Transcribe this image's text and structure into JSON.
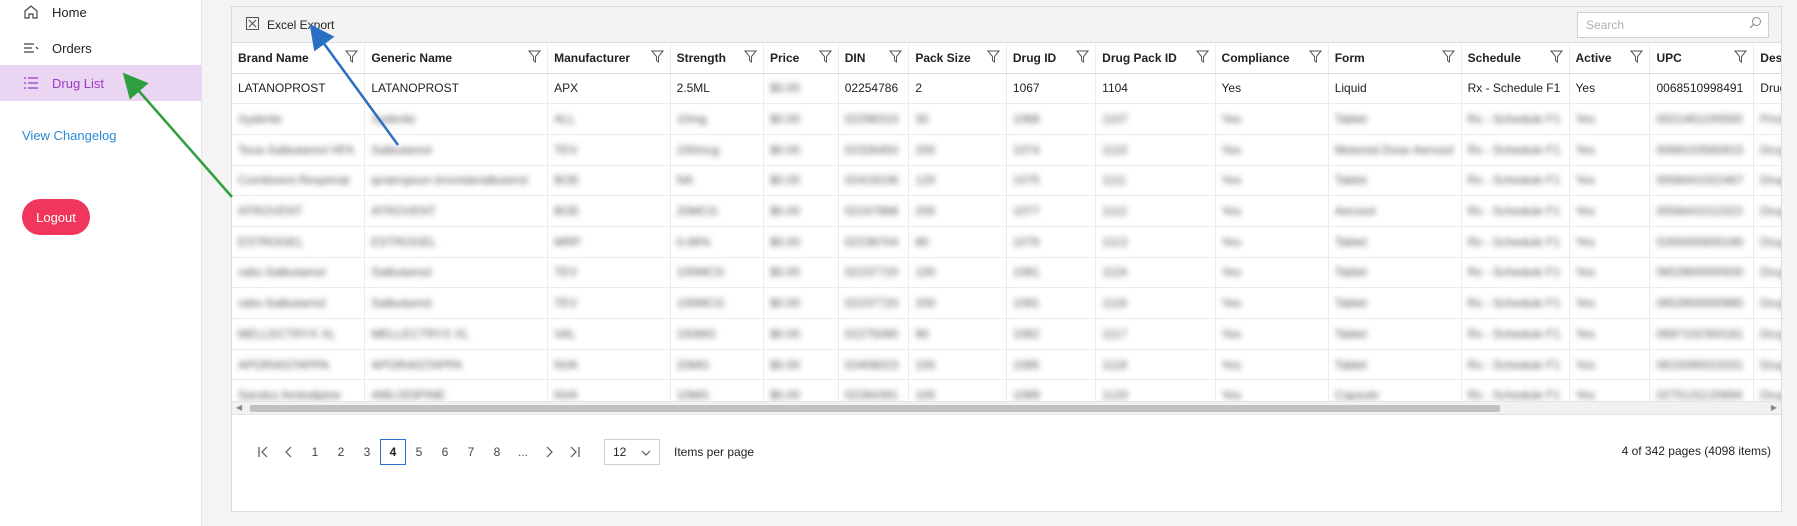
{
  "sidebar": {
    "items": [
      {
        "label": "Home"
      },
      {
        "label": "Orders"
      },
      {
        "label": "Drug List"
      }
    ],
    "changelog_label": "View Changelog",
    "logout_label": "Logout"
  },
  "toolbar": {
    "export_label": "Excel Export",
    "search_placeholder": "Search"
  },
  "columns": [
    "Brand Name",
    "Generic Name",
    "Manufacturer",
    "Strength",
    "Price",
    "DIN",
    "Pack Size",
    "Drug ID",
    "Drug Pack ID",
    "Compliance",
    "Form",
    "Schedule",
    "Active",
    "UPC",
    "Description"
  ],
  "rows": [
    [
      "LATANOPROST",
      "LATANOPROST",
      "APX",
      "2.5ML",
      "$0.00",
      "02254786",
      "2",
      "1067",
      "1104",
      "Yes",
      "Liquid",
      "Rx - Schedule F1",
      "Yes",
      "0068510998491",
      "Drug added via"
    ],
    [
      "Xyderite",
      "Xyderite",
      "ALL",
      "10mg",
      "$0.00",
      "02298310",
      "30",
      "1068",
      "1107",
      "Yes",
      "Tablet",
      "Rx - Schedule F1",
      "Yes",
      "0021461100500",
      "Product Supplied"
    ],
    [
      "Teva-Salbutamol HFA",
      "Salbutamol",
      "TEV",
      "100mcg",
      "$0.00",
      "02326450",
      "200",
      "1074",
      "1110",
      "Yes",
      "Metered Dose Aerosol",
      "Rx - Schedule F1",
      "Yes",
      "0068103560915",
      "Drug added via"
    ],
    [
      "Combivent Respimat",
      "ipratropium bromide/albuterol",
      "BOE",
      "NA",
      "$0.00",
      "02419106",
      "120",
      "1075",
      "1111",
      "Yes",
      "Tablet",
      "Rx - Schedule F1",
      "Yes",
      "0058441022467",
      "Drug added via"
    ],
    [
      "ATROVENT",
      "ATROVENT",
      "BOE",
      "20MCG",
      "$0.00",
      "02247888",
      "200",
      "1077",
      "1112",
      "Yes",
      "Aerosol",
      "Rx - Schedule F1",
      "Yes",
      "0058441011523",
      "Drug added via"
    ],
    [
      "ESTROGEL",
      "ESTROGEL",
      "MRP",
      "0.06%",
      "$0.00",
      "02238704",
      "80",
      "1076",
      "1113",
      "Yes",
      "Tablet",
      "Rx - Schedule F1",
      "Yes",
      "0265000600190",
      "Drug added via"
    ],
    [
      "ratio-Salbutamol",
      "Salbutamol",
      "TEV",
      "100MCG",
      "$0.00",
      "02237720",
      "100",
      "1081",
      "1116",
      "Yes",
      "Tablet",
      "Rx - Schedule F1",
      "Yes",
      "0653900000930",
      "Drug added via"
    ],
    [
      "ratio-Salbutamol",
      "Salbutamol",
      "TEV",
      "100MCG",
      "$0.00",
      "02237720",
      "200",
      "1081",
      "1116",
      "Yes",
      "Tablet",
      "Rx - Schedule F1",
      "Yes",
      "0653900000985",
      "Drug added via"
    ],
    [
      "MELLECTRYX XL",
      "MELLECTRYX XL",
      "VAL",
      "150MG",
      "$0.00",
      "02275090",
      "90",
      "1082",
      "1117",
      "Yes",
      "Tablet",
      "Rx - Schedule F1",
      "Yes",
      "0697102300181",
      "Drug added via"
    ],
    [
      "APORIASTAPPA",
      "APORIASTAPPA",
      "NVA",
      "20MG",
      "$0.00",
      "02408023",
      "100",
      "1085",
      "1118",
      "Yes",
      "Tablet",
      "Rx - Schedule F1",
      "Yes",
      "0815090023331",
      "Drug added via"
    ],
    [
      "Sandoz Amlodipine",
      "AMLODIPINE",
      "NVA",
      "10MG",
      "$0.00",
      "02284391",
      "100",
      "1089",
      "1120",
      "Yes",
      "Capsule",
      "Rx - Schedule F1",
      "Yes",
      "0275131120694",
      "Drug added via"
    ],
    [
      "Sentan CR",
      "Sentanograpide",
      "TEV",
      "80mg",
      "$0.00",
      "02304660",
      "90",
      "1090",
      "1122",
      "Yes",
      "Tablet",
      "Rx - Schedule F1",
      "Yes",
      "0279179159901",
      "Drug added via"
    ]
  ],
  "pager": {
    "pages": [
      "1",
      "2",
      "3",
      "4",
      "5",
      "6",
      "7",
      "8",
      "..."
    ],
    "current": "4",
    "per_page": "12",
    "per_page_label": "Items per page",
    "info": "4 of 342 pages (4098 items)"
  },
  "colors": {
    "accent": "#9b3bbf",
    "active_bg": "#ead5f2",
    "logout": "#f0365a",
    "link": "#2b89d6",
    "arrow_green": "#2e9e3f",
    "arrow_blue": "#2a6fc4"
  }
}
